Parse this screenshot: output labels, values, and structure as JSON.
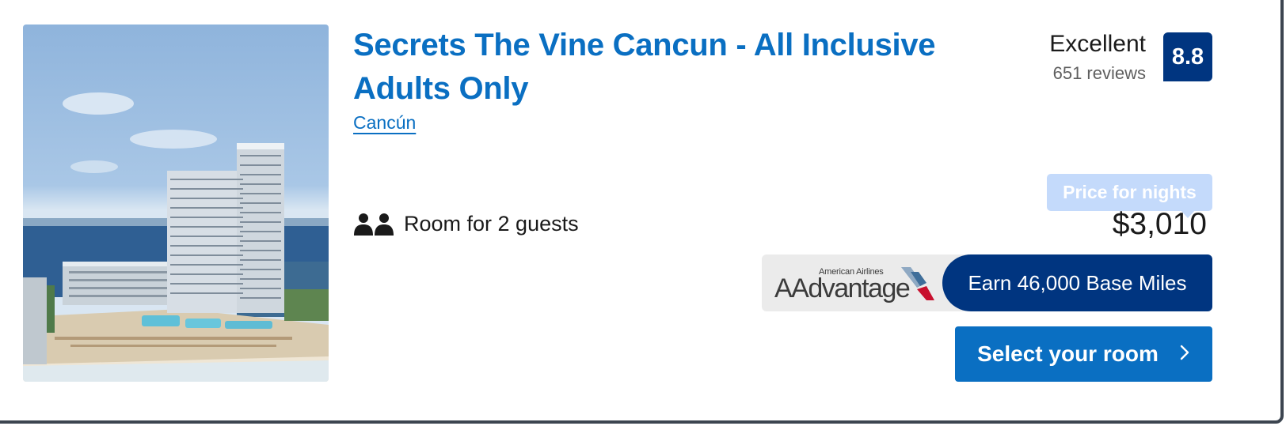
{
  "hotel": {
    "name": "Secrets The Vine Cancun - All Inclusive Adults Only",
    "location": "Cancún",
    "occupancy": "Room for 2 guests",
    "image_icon": "hotel-photo"
  },
  "rating": {
    "label": "Excellent",
    "reviews": "651 reviews",
    "score": "8.8"
  },
  "pricing": {
    "tag": "Price for nights",
    "amount": "$3,010"
  },
  "loyalty": {
    "brand_small": "American Airlines",
    "brand_big": "AAdvantage",
    "miles_text": "Earn 46,000 Base Miles"
  },
  "actions": {
    "select_label": "Select your room",
    "select_icon": "chevron-right-icon"
  },
  "colors": {
    "link_blue": "#0a6fc2",
    "navy": "#003580",
    "price_tag_bg": "#c4dafb",
    "miles_box_bg": "#ebebeb"
  }
}
